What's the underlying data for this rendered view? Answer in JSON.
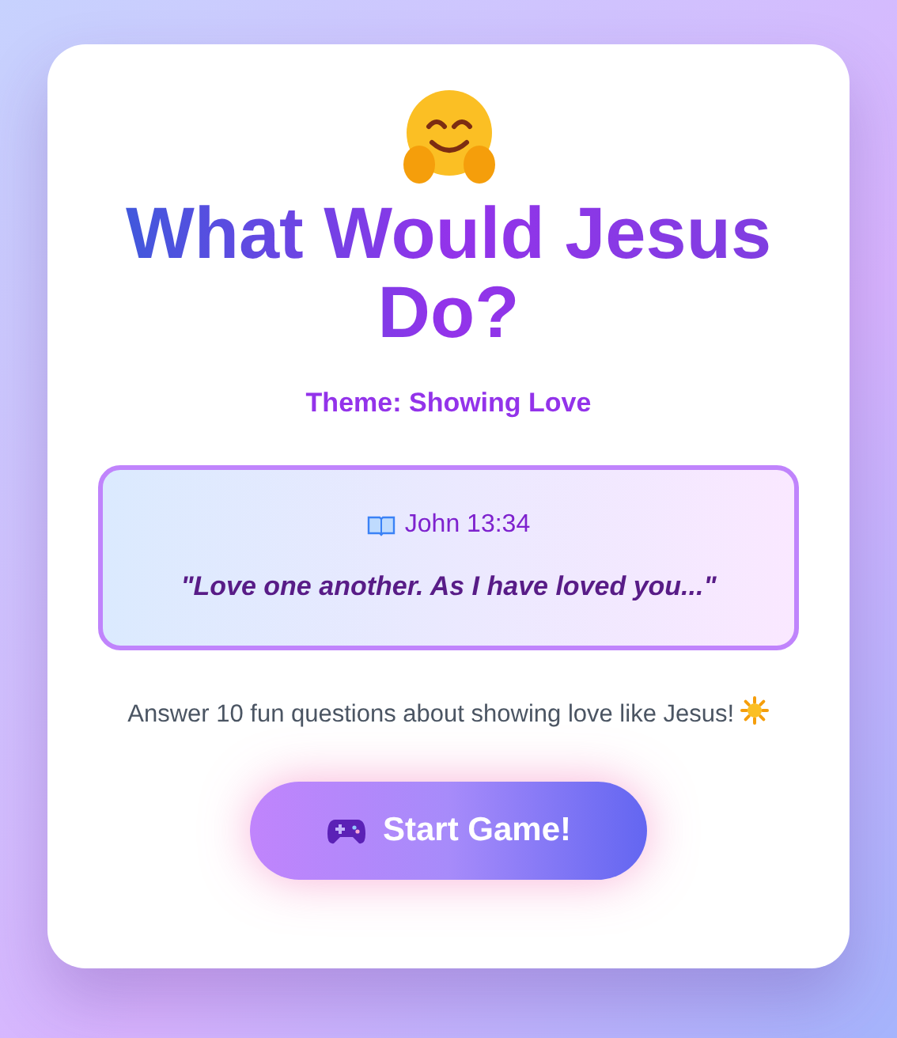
{
  "title": "What Would Jesus Do?",
  "theme": "Theme: Showing Love",
  "verse": {
    "reference": "John 13:34",
    "quote": "\"Love one another. As I have loved you...\""
  },
  "description": "Answer 10 fun questions about showing love like Jesus!",
  "start_button": "Start Game!"
}
